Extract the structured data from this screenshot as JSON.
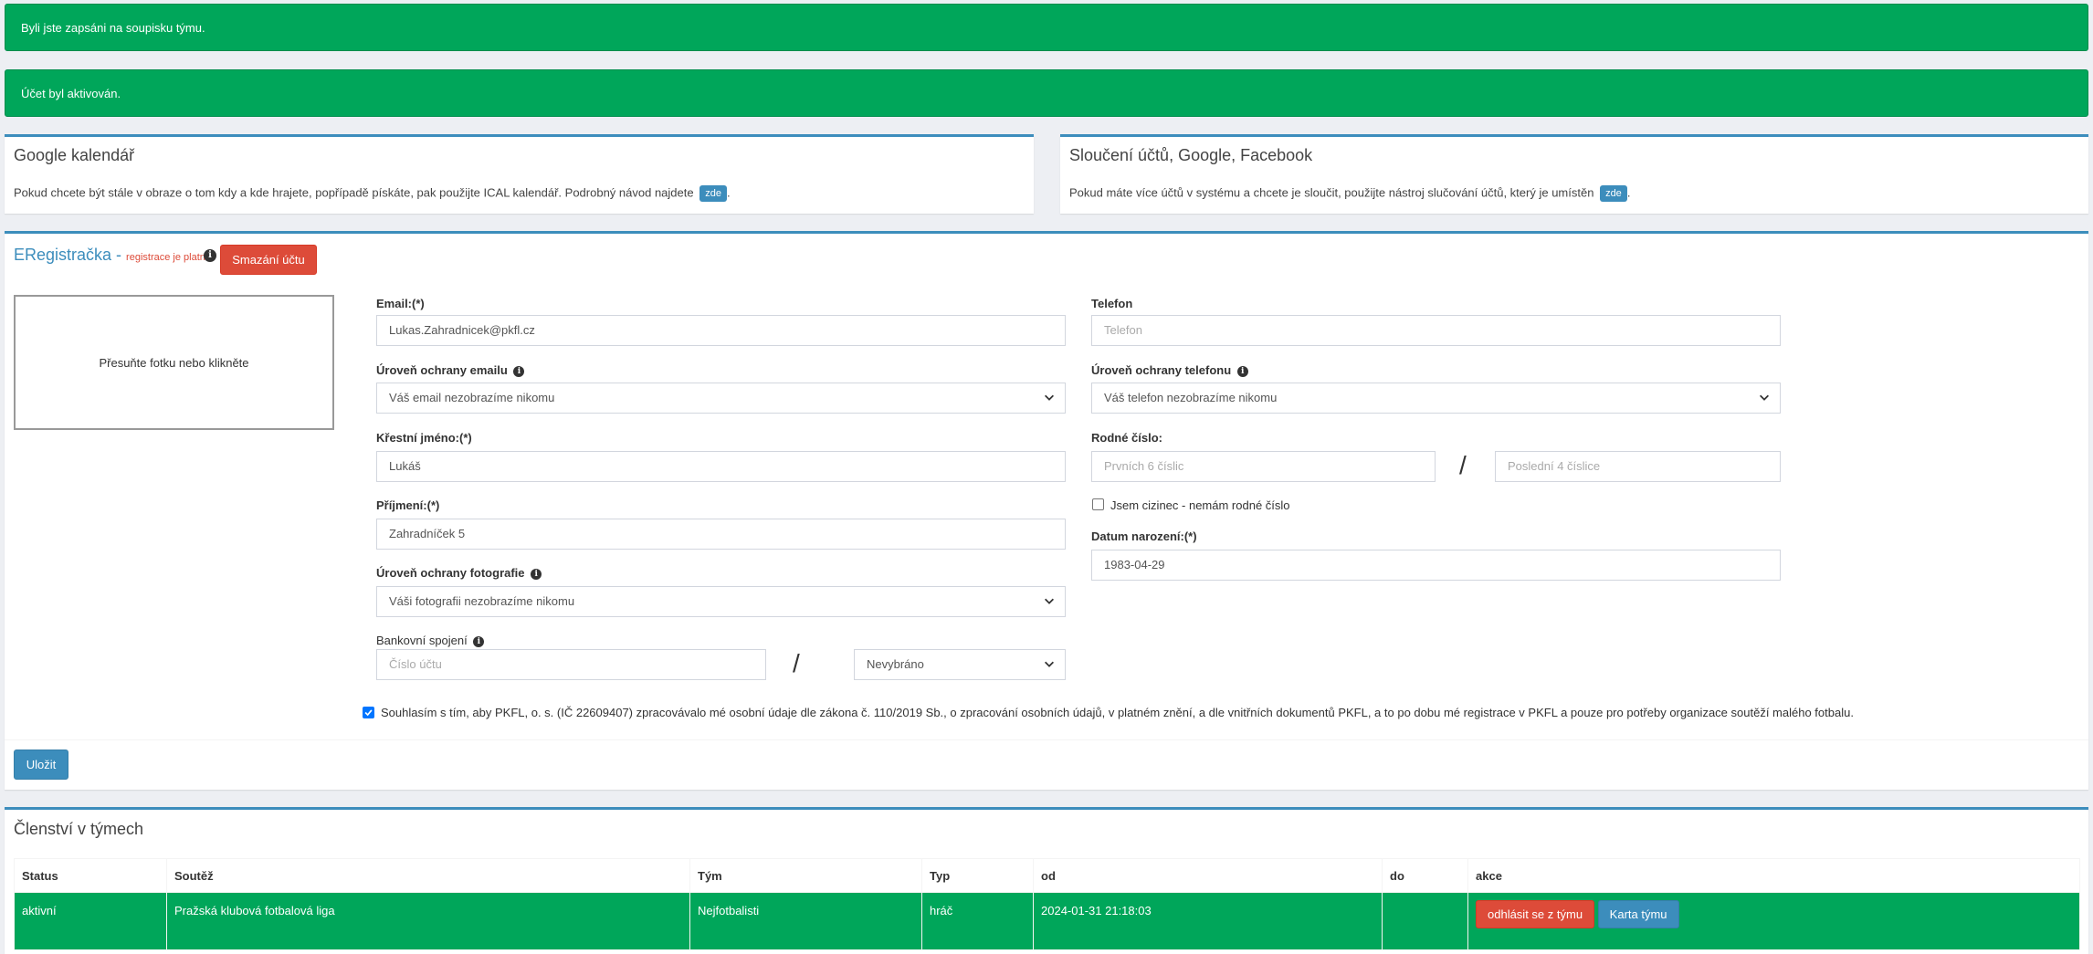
{
  "alerts": [
    "Byli jste zapsáni na soupisku týmu.",
    "Účet byl aktivován."
  ],
  "google_calendar": {
    "title": "Google kalendář",
    "text": "Pokud chcete být stále v obraze o tom kdy a kde hrajete, popřípadě pískáte, pak použijte ICAL kalendář. Podrobný návod najdete",
    "link": "zde",
    "suffix": "."
  },
  "merge_accounts": {
    "title": "Sloučení účtů, Google, Facebook",
    "text": "Pokud máte více účtů v systému a chcete je sloučit, použijte nástroj slučování účtů, který je umístěn",
    "link": "zde",
    "suffix": "."
  },
  "registration": {
    "title": "ERegistračka",
    "dash": " - ",
    "status": "registrace je platná",
    "delete_button": "Smazání účtu",
    "photo_drop": "Přesuňte fotku nebo klikněte",
    "save_button": "Uložit",
    "consent_text": "Souhlasím s tím, aby PKFL, o. s. (IČ 22609407) zpracovávalo mé osobní údaje dle zákona č. 110/2019 Sb., o zpracování osobních údajů, v platném znění, a dle vnitřních dokumentů PKFL, a to po dobu mé registrace v PKFL a pouze pro potřeby organizace soutěží malého fotbalu.",
    "consent_checked": true,
    "fields": {
      "email_label": "Email:(*)",
      "email_value": "Lukas.Zahradnicek@pkfl.cz",
      "email_privacy_label": "Úroveň ochrany emailu",
      "email_privacy_value": "Váš email nezobrazíme nikomu",
      "first_name_label": "Křestní jméno:(*)",
      "first_name_value": "Lukáš",
      "last_name_label": "Příjmení:(*)",
      "last_name_value": "Zahradníček 5",
      "photo_privacy_label": "Úroveň ochrany fotografie",
      "photo_privacy_value": "Váši fotografii nezobrazíme nikomu",
      "bank_label": "Bankovní spojení",
      "bank_account_placeholder": "Číslo účtu",
      "bank_code_value": "Nevybráno",
      "phone_label": "Telefon",
      "phone_placeholder": "Telefon",
      "phone_privacy_label": "Úroveň ochrany telefonu",
      "phone_privacy_value": "Váš telefon nezobrazíme nikomu",
      "birth_number_label": "Rodné číslo:",
      "birth_number_first_placeholder": "Prvních 6 číslic",
      "birth_number_last_placeholder": "Poslední 4 číslice",
      "foreigner_label": "Jsem cizinec - nemám rodné číslo",
      "foreigner_checked": false,
      "birth_date_label": "Datum narození:(*)",
      "birth_date_value": "1983-04-29",
      "slash": "/"
    }
  },
  "membership": {
    "title": "Členství v týmech",
    "columns": [
      "Status",
      "Soutěž",
      "Tým",
      "Typ",
      "od",
      "do",
      "akce"
    ],
    "rows": [
      {
        "status": "aktivní",
        "competition": "Pražská klubová fotbalová liga",
        "team": "Nejfotbalisti",
        "type": "hráč",
        "from": "2024-01-31 21:18:03",
        "to": "",
        "leave_button": "odhlásit se z týmu",
        "card_button": "Karta týmu"
      }
    ]
  },
  "colors": {
    "success": "#00a65a",
    "primary": "#3c8dbc",
    "danger": "#dd4b39",
    "background": "#edeff3"
  }
}
